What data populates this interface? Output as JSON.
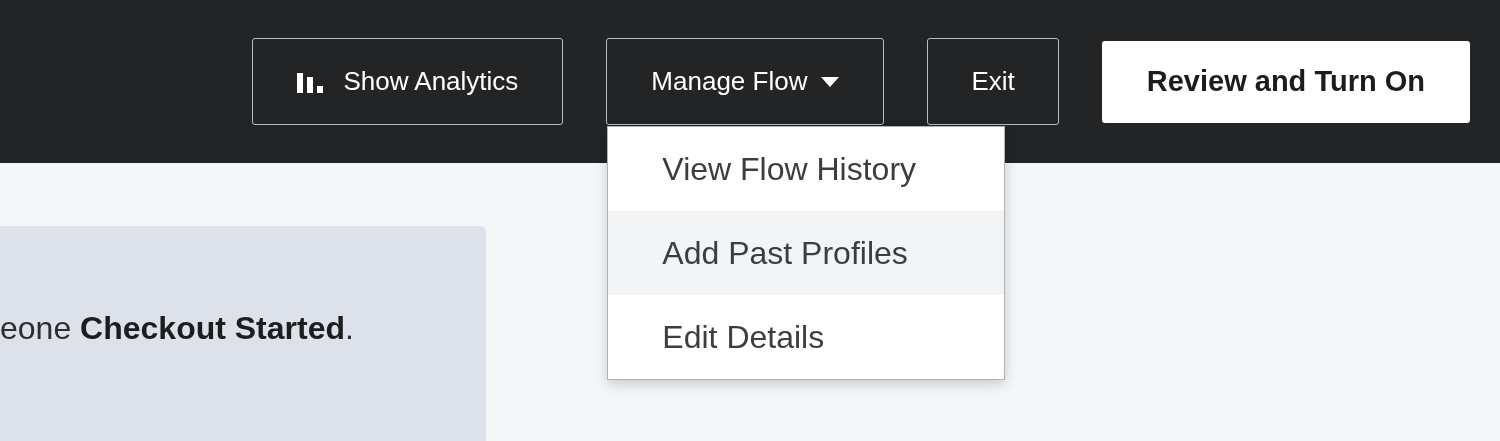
{
  "toolbar": {
    "buttons": [
      {
        "kind": "analytics",
        "label": "Show Analytics"
      },
      {
        "kind": "menu",
        "label": "Manage Flow",
        "expanded": true
      },
      {
        "kind": "plain",
        "label": "Exit"
      },
      {
        "kind": "primary",
        "label": "Review and Turn On"
      }
    ]
  },
  "menu": {
    "items": [
      {
        "label": "View Flow History",
        "highlighted": false
      },
      {
        "label": "Add Past Profiles",
        "highlighted": true
      },
      {
        "label": "Edit Details",
        "highlighted": false
      }
    ]
  },
  "card": {
    "text": "eone **Checkout Started**."
  }
}
